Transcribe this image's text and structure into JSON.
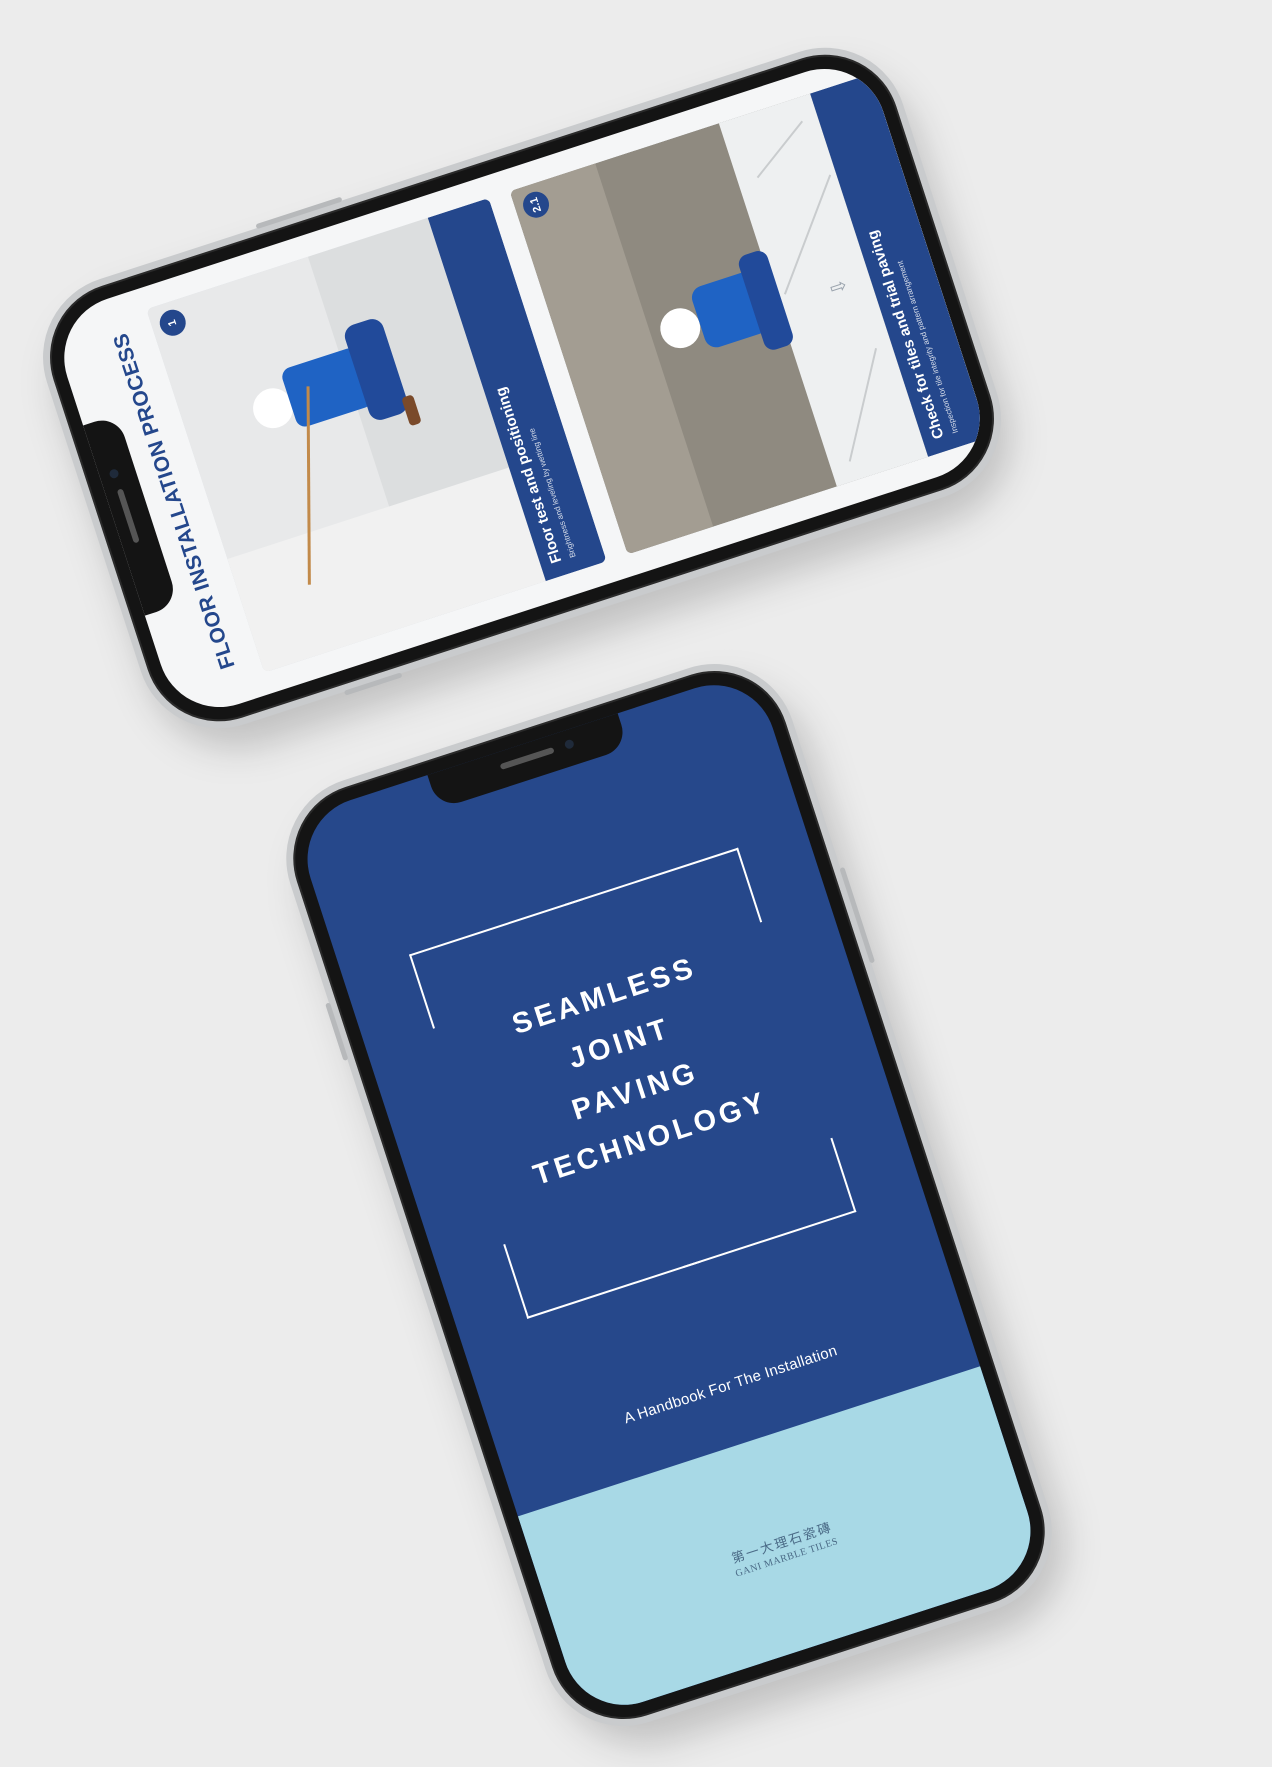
{
  "colors": {
    "background": "#ececec",
    "brand_blue": "#24478c",
    "cover_blue": "#26488b",
    "light_blue": "#a8d9e6"
  },
  "phone1": {
    "title": "FLOOR INSTALLATION PROCESS",
    "cards": [
      {
        "badge": "1",
        "title": "Floor test and positioning",
        "subtitle": "Brightness and leveling by wetting line"
      },
      {
        "badge": "2.1",
        "title": "Check for tiles and trial paving",
        "subtitle": "Inspection for tile integrity and pattern arrangement"
      }
    ],
    "arrow_icon": "arrow-down-icon"
  },
  "phone2": {
    "title_lines": [
      "SEAMLESS",
      "JOINT",
      "PAVING",
      "TECHNOLOGY"
    ],
    "subtitle": "A Handbook For The Installation",
    "brand_cn": "第一大理石瓷磚",
    "brand_en": "GANI MARBLE TILES"
  }
}
